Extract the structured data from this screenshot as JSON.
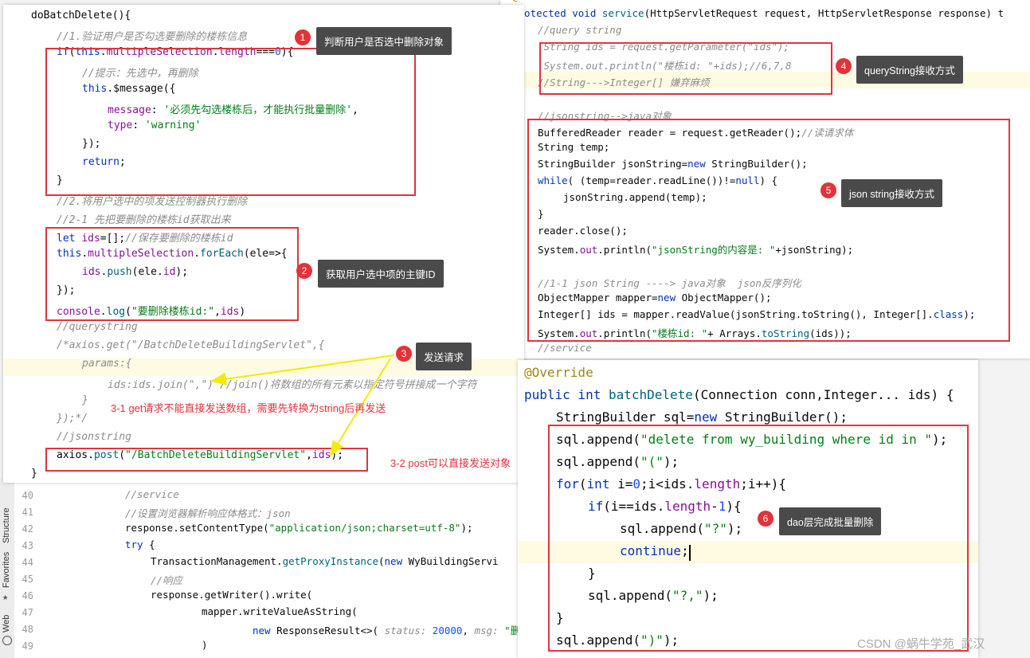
{
  "left_panel": {
    "lines": [
      {
        "indent": 0,
        "parts": [
          {
            "c": "plain",
            "t": "doBatchDelete(){"
          }
        ]
      },
      {
        "indent": 1,
        "parts": [
          {
            "c": "cm",
            "t": "//1.验证用户是否勾选要删除的楼栋信息"
          }
        ]
      },
      {
        "indent": 1,
        "parts": [
          {
            "c": "kw",
            "t": "if"
          },
          {
            "c": "plain",
            "t": "("
          },
          {
            "c": "kw",
            "t": "this"
          },
          {
            "c": "plain",
            "t": "."
          },
          {
            "c": "fld",
            "t": "multipleSelection"
          },
          {
            "c": "plain",
            "t": "."
          },
          {
            "c": "fld",
            "t": "length"
          },
          {
            "c": "plain",
            "t": "==="
          },
          {
            "c": "num",
            "t": "0"
          },
          {
            "c": "plain",
            "t": "){"
          }
        ]
      },
      {
        "indent": 2,
        "parts": [
          {
            "c": "cm",
            "t": "//提示：先选中，再删除"
          }
        ]
      },
      {
        "indent": 2,
        "parts": [
          {
            "c": "kw",
            "t": "this"
          },
          {
            "c": "plain",
            "t": ".$message({"
          }
        ]
      },
      {
        "indent": 3,
        "parts": [
          {
            "c": "fld",
            "t": "message"
          },
          {
            "c": "plain",
            "t": ": "
          },
          {
            "c": "str",
            "t": "'必须先勾选楼栋后，才能执行批量删除'"
          },
          {
            "c": "plain",
            "t": ","
          }
        ]
      },
      {
        "indent": 3,
        "parts": [
          {
            "c": "fld",
            "t": "type"
          },
          {
            "c": "plain",
            "t": ": "
          },
          {
            "c": "str",
            "t": "'warning'"
          }
        ]
      },
      {
        "indent": 2,
        "parts": [
          {
            "c": "plain",
            "t": "});"
          }
        ]
      },
      {
        "indent": 2,
        "parts": [
          {
            "c": "kw",
            "t": "return"
          },
          {
            "c": "plain",
            "t": ";"
          }
        ]
      },
      {
        "indent": 1,
        "parts": [
          {
            "c": "plain",
            "t": "}"
          }
        ]
      },
      {
        "indent": 1,
        "parts": [
          {
            "c": "cm",
            "t": "//2.将用户选中的项发送控制器执行删除"
          }
        ]
      },
      {
        "indent": 1,
        "parts": [
          {
            "c": "cm",
            "t": "//2-1 先把要删除的楼栋id获取出来"
          }
        ]
      },
      {
        "indent": 1,
        "parts": [
          {
            "c": "kw",
            "t": "let "
          },
          {
            "c": "fld",
            "t": "ids"
          },
          {
            "c": "plain",
            "t": "=[];"
          },
          {
            "c": "cm",
            "t": "//保存要删除的楼栋id"
          }
        ]
      },
      {
        "indent": 1,
        "parts": [
          {
            "c": "kw",
            "t": "this"
          },
          {
            "c": "plain",
            "t": "."
          },
          {
            "c": "fld",
            "t": "multipleSelection"
          },
          {
            "c": "plain",
            "t": "."
          },
          {
            "c": "fn",
            "t": "forEach"
          },
          {
            "c": "plain",
            "t": "("
          },
          {
            "c": "plain",
            "t": "ele"
          },
          {
            "c": "plain",
            "t": "=>{"
          }
        ]
      },
      {
        "indent": 2,
        "parts": [
          {
            "c": "fld",
            "t": "ids"
          },
          {
            "c": "plain",
            "t": "."
          },
          {
            "c": "fn",
            "t": "push"
          },
          {
            "c": "plain",
            "t": "("
          },
          {
            "c": "plain",
            "t": "ele"
          },
          {
            "c": "plain",
            "t": "."
          },
          {
            "c": "fld",
            "t": "id"
          },
          {
            "c": "plain",
            "t": ");"
          }
        ]
      },
      {
        "indent": 1,
        "parts": [
          {
            "c": "plain",
            "t": "});"
          }
        ]
      },
      {
        "indent": 1,
        "parts": [
          {
            "c": "fld",
            "t": "console"
          },
          {
            "c": "plain",
            "t": "."
          },
          {
            "c": "fn",
            "t": "log"
          },
          {
            "c": "plain",
            "t": "("
          },
          {
            "c": "str",
            "t": "\"要删除楼栋id:\""
          },
          {
            "c": "plain",
            "t": ","
          },
          {
            "c": "fld",
            "t": "ids"
          },
          {
            "c": "plain",
            "t": ")"
          }
        ]
      },
      {
        "indent": 1,
        "parts": [
          {
            "c": "cm",
            "t": "//querystring"
          }
        ]
      },
      {
        "indent": 1,
        "parts": [
          {
            "c": "cm",
            "t": "/*axios.get(\"/BatchDeleteBuildingServlet\",{"
          }
        ]
      },
      {
        "indent": 2,
        "parts": [
          {
            "c": "cm",
            "t": "params:{"
          }
        ]
      },
      {
        "indent": 3,
        "parts": [
          {
            "c": "cm",
            "t": "ids:ids.join(\",\") //join()将数组的所有元素以指定符号拼接成一个字符"
          }
        ]
      },
      {
        "indent": 2,
        "parts": [
          {
            "c": "cm",
            "t": "}"
          }
        ]
      },
      {
        "indent": 1,
        "parts": [
          {
            "c": "cm",
            "t": "});*/"
          }
        ]
      },
      {
        "indent": 1,
        "parts": [
          {
            "c": "cm",
            "t": "//jsonstring"
          }
        ]
      },
      {
        "indent": 1,
        "parts": [
          {
            "c": "plain",
            "t": "axios."
          },
          {
            "c": "fn",
            "t": "post"
          },
          {
            "c": "plain",
            "t": "("
          },
          {
            "c": "str",
            "t": "\"/BatchDeleteBuildingServlet\""
          },
          {
            "c": "plain",
            "t": ","
          },
          {
            "c": "fld",
            "t": "ids"
          },
          {
            "c": "plain",
            "t": ");"
          }
        ]
      },
      {
        "indent": 0,
        "parts": [
          {
            "c": "plain",
            "t": "}"
          }
        ]
      }
    ]
  },
  "top_right_panel": {
    "lines": [
      {
        "indent": 0,
        "parts": [
          {
            "c": "ann",
            "t": "@Override"
          }
        ]
      },
      {
        "indent": 0,
        "parts": [
          {
            "c": "kw",
            "t": "protected void "
          },
          {
            "c": "fn",
            "t": "service"
          },
          {
            "c": "plain",
            "t": "(HttpServletRequest request, HttpServletResponse response) t"
          }
        ]
      },
      {
        "indent": 1,
        "parts": [
          {
            "c": "cm",
            "t": "//query string"
          }
        ]
      },
      {
        "indent": 1,
        "parts": [
          {
            "c": "cm",
            "t": " String ids = request.getParameter(\"ids\");"
          }
        ]
      },
      {
        "indent": 1,
        "parts": [
          {
            "c": "cm",
            "t": " System.out.println(\"楼栋id: \"+ids);//6,7,8"
          }
        ]
      },
      {
        "indent": 1,
        "parts": [
          {
            "c": "cm",
            "t": "//String--->Integer[] 嫌弃麻烦"
          }
        ]
      },
      {
        "indent": 1,
        "parts": [
          {
            "c": "plain",
            "t": ""
          }
        ]
      },
      {
        "indent": 1,
        "parts": [
          {
            "c": "cm",
            "t": "//jsonstring-->java对象"
          }
        ]
      },
      {
        "indent": 1,
        "parts": [
          {
            "c": "plain",
            "t": "BufferedReader reader = request.getReader();"
          },
          {
            "c": "cm",
            "t": "//读请求体"
          }
        ]
      },
      {
        "indent": 1,
        "parts": [
          {
            "c": "plain",
            "t": "String temp;"
          }
        ]
      },
      {
        "indent": 1,
        "parts": [
          {
            "c": "plain",
            "t": "StringBuilder jsonString="
          },
          {
            "c": "kw",
            "t": "new "
          },
          {
            "c": "plain",
            "t": "StringBuilder();"
          }
        ]
      },
      {
        "indent": 1,
        "parts": [
          {
            "c": "kw",
            "t": "while"
          },
          {
            "c": "plain",
            "t": "( (temp=reader.readLine())!="
          },
          {
            "c": "kw",
            "t": "null"
          },
          {
            "c": "plain",
            "t": ") {"
          }
        ]
      },
      {
        "indent": 2,
        "parts": [
          {
            "c": "plain",
            "t": "jsonString.append(temp);"
          }
        ]
      },
      {
        "indent": 1,
        "parts": [
          {
            "c": "plain",
            "t": "}"
          }
        ]
      },
      {
        "indent": 1,
        "parts": [
          {
            "c": "plain",
            "t": "reader.close();"
          }
        ]
      },
      {
        "indent": 1,
        "parts": [
          {
            "c": "plain",
            "t": "System."
          },
          {
            "c": "fld",
            "t": "out"
          },
          {
            "c": "plain",
            "t": ".println("
          },
          {
            "c": "str",
            "t": "\"jsonString的内容是: \""
          },
          {
            "c": "plain",
            "t": "+jsonString);"
          }
        ]
      },
      {
        "indent": 1,
        "parts": [
          {
            "c": "plain",
            "t": ""
          }
        ]
      },
      {
        "indent": 1,
        "parts": [
          {
            "c": "cm",
            "t": "//1-1 json String ----> java对象  json反序列化"
          }
        ]
      },
      {
        "indent": 1,
        "parts": [
          {
            "c": "plain",
            "t": "ObjectMapper mapper="
          },
          {
            "c": "kw",
            "t": "new "
          },
          {
            "c": "plain",
            "t": "ObjectMapper();"
          }
        ]
      },
      {
        "indent": 1,
        "parts": [
          {
            "c": "plain",
            "t": "Integer[] ids = mapper.readValue(jsonString.toString(), Integer[]."
          },
          {
            "c": "kw",
            "t": "class"
          },
          {
            "c": "plain",
            "t": ");"
          }
        ]
      },
      {
        "indent": 1,
        "parts": [
          {
            "c": "plain",
            "t": "System."
          },
          {
            "c": "fld",
            "t": "out"
          },
          {
            "c": "plain",
            "t": ".println("
          },
          {
            "c": "str",
            "t": "\"楼栋id: \""
          },
          {
            "c": "plain",
            "t": "+ Arrays."
          },
          {
            "c": "fn",
            "t": "toString"
          },
          {
            "c": "plain",
            "t": "(ids));"
          }
        ]
      },
      {
        "indent": 1,
        "parts": [
          {
            "c": "cm",
            "t": "//service"
          }
        ]
      }
    ]
  },
  "bottom_right_panel": {
    "lines": [
      {
        "indent": 0,
        "parts": [
          {
            "c": "ann",
            "t": "@Override"
          }
        ]
      },
      {
        "indent": 0,
        "parts": [
          {
            "c": "kw",
            "t": "public int "
          },
          {
            "c": "fn",
            "t": "batchDelete"
          },
          {
            "c": "plain",
            "t": "(Connection conn,Integer... ids) {"
          }
        ]
      },
      {
        "indent": 1,
        "parts": [
          {
            "c": "plain",
            "t": "StringBuilder sql="
          },
          {
            "c": "kw",
            "t": "new "
          },
          {
            "c": "plain",
            "t": "StringBuilder();"
          }
        ]
      },
      {
        "indent": 1,
        "parts": [
          {
            "c": "plain",
            "t": "sql.append("
          },
          {
            "c": "str",
            "t": "\"delete from wy_building where id in \""
          },
          {
            "c": "plain",
            "t": ");"
          }
        ]
      },
      {
        "indent": 1,
        "parts": [
          {
            "c": "plain",
            "t": "sql.append("
          },
          {
            "c": "str",
            "t": "\"(\""
          },
          {
            "c": "plain",
            "t": ");"
          }
        ]
      },
      {
        "indent": 1,
        "parts": [
          {
            "c": "kw",
            "t": "for"
          },
          {
            "c": "plain",
            "t": "("
          },
          {
            "c": "kw",
            "t": "int "
          },
          {
            "c": "plain",
            "t": "i="
          },
          {
            "c": "num",
            "t": "0"
          },
          {
            "c": "plain",
            "t": ";i<ids."
          },
          {
            "c": "fld",
            "t": "length"
          },
          {
            "c": "plain",
            "t": ";i++){"
          }
        ]
      },
      {
        "indent": 2,
        "parts": [
          {
            "c": "kw",
            "t": "if"
          },
          {
            "c": "plain",
            "t": "(i==ids."
          },
          {
            "c": "fld",
            "t": "length"
          },
          {
            "c": "plain",
            "t": "-"
          },
          {
            "c": "num",
            "t": "1"
          },
          {
            "c": "plain",
            "t": "){"
          }
        ]
      },
      {
        "indent": 3,
        "parts": [
          {
            "c": "plain",
            "t": "sql.append("
          },
          {
            "c": "str",
            "t": "\"?\""
          },
          {
            "c": "plain",
            "t": ");"
          }
        ]
      },
      {
        "indent": 3,
        "parts": [
          {
            "c": "kw",
            "t": "continue"
          },
          {
            "c": "plain",
            "t": ";"
          }
        ]
      },
      {
        "indent": 2,
        "parts": [
          {
            "c": "plain",
            "t": "}"
          }
        ]
      },
      {
        "indent": 2,
        "parts": [
          {
            "c": "plain",
            "t": "sql.append("
          },
          {
            "c": "str",
            "t": "\"?,\""
          },
          {
            "c": "plain",
            "t": ");"
          }
        ]
      },
      {
        "indent": 1,
        "parts": [
          {
            "c": "plain",
            "t": "}"
          }
        ]
      },
      {
        "indent": 1,
        "parts": [
          {
            "c": "plain",
            "t": "sql.append("
          },
          {
            "c": "str",
            "t": "\")\""
          },
          {
            "c": "plain",
            "t": ");"
          }
        ]
      }
    ]
  },
  "background_editor": {
    "line_numbers": [
      "40",
      "41",
      "42",
      "43",
      "44",
      "45",
      "46",
      "47",
      "48",
      "49"
    ],
    "lines": [
      {
        "indent": 2,
        "parts": [
          {
            "c": "cm",
            "t": "//service"
          }
        ]
      },
      {
        "indent": 2,
        "parts": [
          {
            "c": "cm",
            "t": "//设置浏览器解析响应体格式：json"
          }
        ]
      },
      {
        "indent": 2,
        "parts": [
          {
            "c": "plain",
            "t": "response.setContentType("
          },
          {
            "c": "str",
            "t": "\"application/json;charset=utf-8\""
          },
          {
            "c": "plain",
            "t": ");"
          }
        ]
      },
      {
        "indent": 2,
        "parts": [
          {
            "c": "kw",
            "t": "try "
          },
          {
            "c": "plain",
            "t": "{"
          }
        ]
      },
      {
        "indent": 3,
        "parts": [
          {
            "c": "plain",
            "t": "TransactionManagement."
          },
          {
            "c": "fn",
            "t": "getProxyInstance"
          },
          {
            "c": "plain",
            "t": "("
          },
          {
            "c": "kw",
            "t": "new "
          },
          {
            "c": "plain",
            "t": "WyBuildingServi"
          }
        ]
      },
      {
        "indent": 3,
        "parts": [
          {
            "c": "cm",
            "t": "//响应"
          }
        ]
      },
      {
        "indent": 3,
        "parts": [
          {
            "c": "plain",
            "t": "response.getWriter().write("
          }
        ]
      },
      {
        "indent": 5,
        "parts": [
          {
            "c": "plain",
            "t": "mapper.writeValueAsString("
          }
        ]
      },
      {
        "indent": 7,
        "parts": [
          {
            "c": "kw",
            "t": "new "
          },
          {
            "c": "plain",
            "t": "ResponseResult<>( "
          },
          {
            "c": "cm",
            "t": "status: "
          },
          {
            "c": "num",
            "t": "20000"
          },
          {
            "c": "plain",
            "t": ", "
          },
          {
            "c": "cm",
            "t": "msg: "
          },
          {
            "c": "str",
            "t": "\"删"
          }
        ]
      },
      {
        "indent": 5,
        "parts": [
          {
            "c": "plain",
            "t": ")"
          }
        ]
      }
    ],
    "side_tabs": [
      "Structure",
      "Favorites",
      "Web"
    ]
  },
  "callouts": [
    {
      "num": "1",
      "text": "判断用户是否选中删除对象"
    },
    {
      "num": "2",
      "text": "获取用户选中项的主键ID"
    },
    {
      "num": "3",
      "text": "发送请求"
    },
    {
      "num": "4",
      "text": "queryString接收方式"
    },
    {
      "num": "5",
      "text": "json string接收方式"
    },
    {
      "num": "6",
      "text": "dao层完成批量删除"
    }
  ],
  "notes": {
    "get_note": "3-1 get请求不能直接发送数组，需要先转换为string后再发送",
    "post_note": "3-2 post可以直接发送对象"
  },
  "watermark": "CSDN @蜗牛学苑_武汉",
  "colors": {
    "annotation_red": "#e2323a",
    "callout_bg": "#4a4a4a",
    "arrow_yellow": "#f5e90a"
  }
}
